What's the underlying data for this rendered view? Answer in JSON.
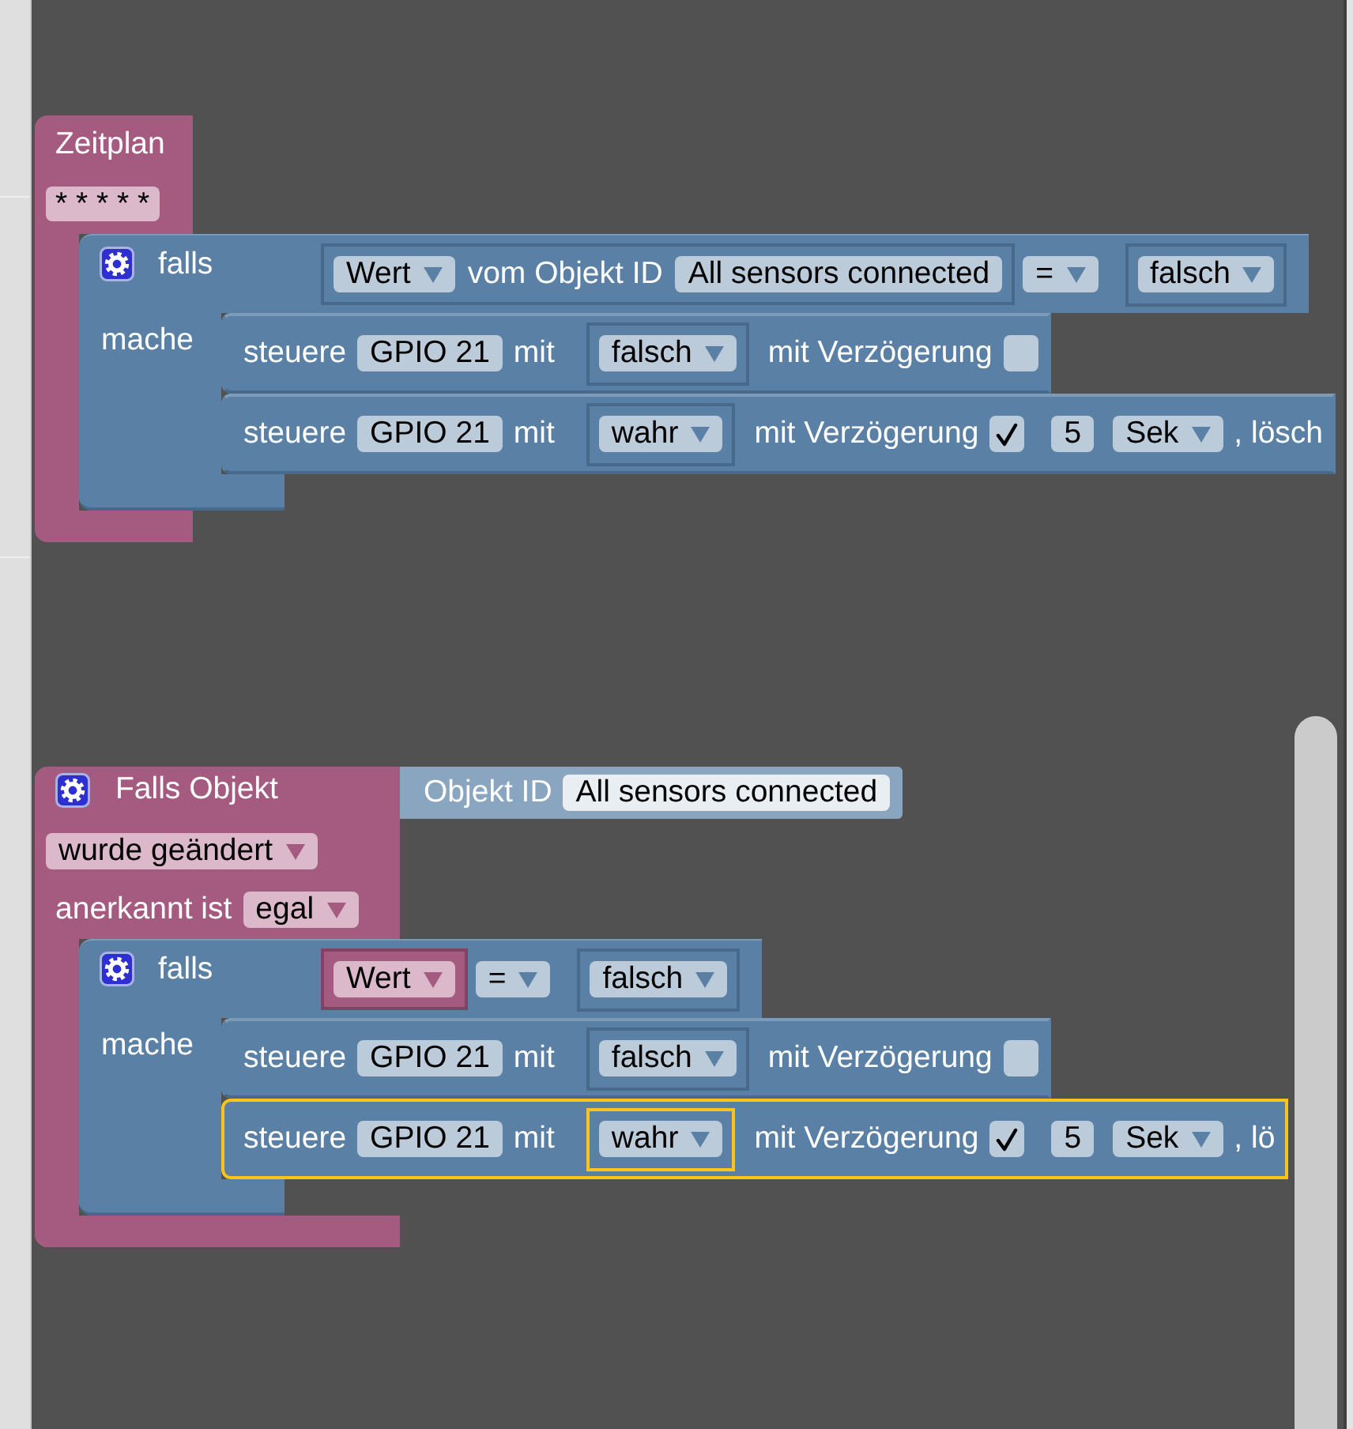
{
  "workspace": {
    "blocks": [
      {
        "kind": "schedule",
        "title": "Zeitplan",
        "cron": "* * * * *",
        "body": {
          "kind": "if",
          "gear": true,
          "label": "falls",
          "do_label": "mache",
          "condition": {
            "kind": "compare",
            "left": {
              "kind": "object_value",
              "attribute": "Wert",
              "label": "vom Objekt ID",
              "object_id": "All sensors connected"
            },
            "operator": "=",
            "right": {
              "kind": "boolean",
              "value": "falsch",
              "selected": false
            }
          },
          "statements": [
            {
              "kind": "control",
              "label": "steuere",
              "target": "GPIO 21",
              "with_label": "mit",
              "value": {
                "kind": "boolean",
                "value": "falsch",
                "selected": false
              },
              "delay_label": "mit Verzögerung",
              "delay": false,
              "selected": false
            },
            {
              "kind": "control",
              "label": "steuere",
              "target": "GPIO 21",
              "with_label": "mit",
              "value": {
                "kind": "boolean",
                "value": "wahr",
                "selected": false
              },
              "delay_label": "mit Verzögerung",
              "delay": true,
              "delay_value": "5",
              "unit": "Sek",
              "tail": ", lösch",
              "selected": false
            }
          ]
        }
      },
      {
        "kind": "trigger",
        "gear": true,
        "title": "Falls Objekt",
        "input": {
          "label": "Objekt ID",
          "object_id": "All sensors connected"
        },
        "event": "wurde geändert",
        "ack_label": "anerkannt ist",
        "ack": "egal",
        "body": {
          "kind": "if",
          "gear": true,
          "label": "falls",
          "do_label": "mache",
          "condition": {
            "kind": "compare",
            "left": {
              "kind": "trigger_value",
              "attribute": "Wert"
            },
            "operator": "=",
            "right": {
              "kind": "boolean",
              "value": "falsch",
              "selected": false
            }
          },
          "statements": [
            {
              "kind": "control",
              "label": "steuere",
              "target": "GPIO 21",
              "with_label": "mit",
              "value": {
                "kind": "boolean",
                "value": "falsch",
                "selected": false
              },
              "delay_label": "mit Verzögerung",
              "delay": false,
              "selected": false
            },
            {
              "kind": "control",
              "label": "steuere",
              "target": "GPIO 21",
              "with_label": "mit",
              "value": {
                "kind": "boolean",
                "value": "wahr",
                "selected": true
              },
              "delay_label": "mit Verzögerung",
              "delay": true,
              "delay_value": "5",
              "unit": "Sek",
              "tail": ", lö",
              "selected": true
            }
          ]
        }
      }
    ]
  }
}
